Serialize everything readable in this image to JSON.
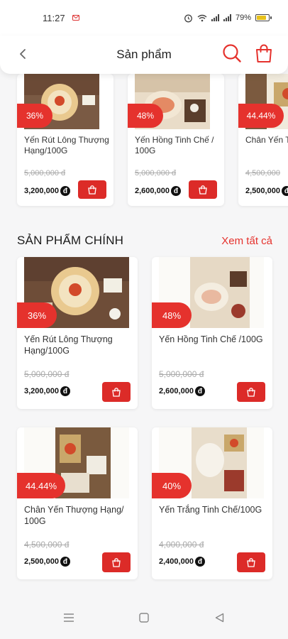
{
  "status": {
    "time": "11:27",
    "battery": "79%"
  },
  "header": {
    "title": "Sản phẩm"
  },
  "carousel": [
    {
      "discount": "36%",
      "name": "Yến Rút Lông Thượng Hạng/100G",
      "old_price": "5,000,000 đ",
      "new_price": "3,200,000"
    },
    {
      "discount": "48%",
      "name": "Yến Hồng Tinh Chế / 100G",
      "old_price": "5,000,000 đ",
      "new_price": "2,600,000"
    },
    {
      "discount": "44.44%",
      "name": "Chân Yến Thượng",
      "old_price": "4,500,000",
      "new_price": "2,500,000"
    }
  ],
  "section": {
    "title": "SẢN PHẨM CHÍNH",
    "see_all": "Xem tất cả"
  },
  "products": [
    {
      "discount": "36%",
      "name": "Yến Rút Lông Thượng Hạng/100G",
      "old_price": "5,000,000 đ",
      "new_price": "3,200,000"
    },
    {
      "discount": "48%",
      "name": "Yến Hồng Tinh Chế /100G",
      "old_price": "5,000,000 đ",
      "new_price": "2,600,000"
    },
    {
      "discount": "44.44%",
      "name": "Chân Yến Thượng Hạng/ 100G",
      "old_price": "4,500,000 đ",
      "new_price": "2,500,000"
    },
    {
      "discount": "40%",
      "name": "Yến Trắng Tinh Chế/100G",
      "old_price": "4,000,000 đ",
      "new_price": "2,400,000"
    }
  ],
  "currency_symbol": "đ",
  "colors": {
    "accent": "#e5322d",
    "cart_button": "#dc2b28",
    "battery": "#e7c11a"
  }
}
